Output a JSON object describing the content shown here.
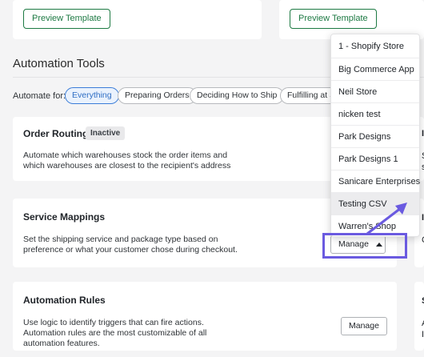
{
  "top_cards": [
    {
      "preview_label": "Preview Template"
    },
    {
      "preview_label": "Preview Template"
    }
  ],
  "section": {
    "title": "Automation Tools"
  },
  "filters": {
    "label": "Automate for:",
    "chips": [
      "Everything",
      "Preparing Orders",
      "Deciding How to Ship",
      "Fulfilling at Sc"
    ],
    "active_index": 0
  },
  "cards": [
    {
      "title": "Order Routing",
      "badge": "Inactive",
      "description": "Automate which warehouses stock the order items and which warehouses are closest to the recipient's address"
    },
    {
      "title": "Service Mappings",
      "description": "Set the shipping service and package type based on preference or what your customer chose during checkout.",
      "button_label": "Manage",
      "button_icon": "caret-up-icon"
    },
    {
      "title": "Automation Rules",
      "description": "Use logic to identify triggers that can fire actions. Automation rules are the most customizable of all automation features.",
      "button_label": "Manage"
    }
  ],
  "store_dropdown": {
    "items": [
      "1 - Shopify Store",
      "Big Commerce App",
      "Neil Store",
      "nicken test",
      "Park Designs",
      "Park Designs 1",
      "Sanicare Enterprises",
      "Testing CSV",
      "Warren's Shop"
    ],
    "hover_index": 7
  },
  "right_edge_fragments": [
    "I",
    "S",
    "s",
    "I",
    "C",
    "S",
    "A",
    "I"
  ],
  "colors": {
    "green": "#1d7a43",
    "accent_blue": "#3b7dd8",
    "annotation": "#6a5ae0"
  }
}
